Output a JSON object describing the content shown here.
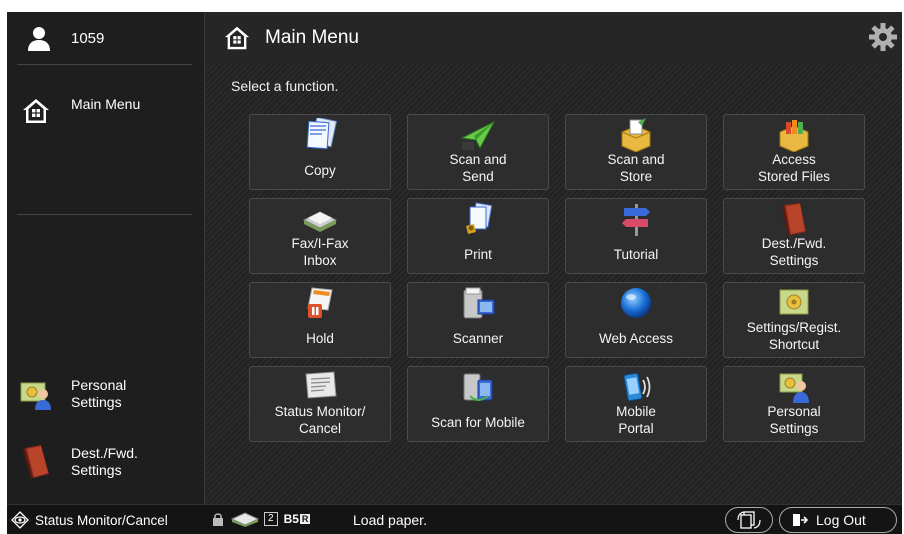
{
  "sidebar": {
    "user_id": "1059",
    "main_menu_label": "Main Menu",
    "shortcuts": [
      {
        "label": "Personal\nSettings",
        "icon": "personal-settings-icon"
      },
      {
        "label": "Dest./Fwd.\nSettings",
        "icon": "address-book-icon"
      }
    ]
  },
  "header": {
    "title": "Main Menu"
  },
  "main": {
    "prompt": "Select a function.",
    "tiles": [
      {
        "label": "Copy",
        "icon": "copy-icon"
      },
      {
        "label": "Scan and\nSend",
        "icon": "scan-send-icon"
      },
      {
        "label": "Scan and\nStore",
        "icon": "scan-store-icon"
      },
      {
        "label": "Access\nStored Files",
        "icon": "stored-files-icon"
      },
      {
        "label": "Fax/I-Fax\nInbox",
        "icon": "fax-inbox-icon"
      },
      {
        "label": "Print",
        "icon": "print-icon"
      },
      {
        "label": "Tutorial",
        "icon": "tutorial-icon"
      },
      {
        "label": "Dest./Fwd.\nSettings",
        "icon": "address-book-icon"
      },
      {
        "label": "Hold",
        "icon": "hold-icon"
      },
      {
        "label": "Scanner",
        "icon": "scanner-icon"
      },
      {
        "label": "Web Access",
        "icon": "globe-icon"
      },
      {
        "label": "Settings/Regist.\nShortcut",
        "icon": "settings-shortcut-icon"
      },
      {
        "label": "Status Monitor/\nCancel",
        "icon": "status-monitor-icon"
      },
      {
        "label": "Scan for Mobile",
        "icon": "scan-mobile-icon"
      },
      {
        "label": "Mobile\nPortal",
        "icon": "mobile-portal-icon"
      },
      {
        "label": "Personal\nSettings",
        "icon": "personal-settings-icon"
      }
    ]
  },
  "statusbar": {
    "status_monitor_label": "Status Monitor/Cancel",
    "tray_number": "2",
    "paper_size": "B5",
    "paper_orientation": "R",
    "message": "Load paper.",
    "logout_label": "Log Out"
  },
  "colors": {
    "background": "#1a1a1a",
    "tile": "#2d2d2d",
    "accent_green": "#4caf50",
    "accent_orange": "#f08c1e"
  }
}
